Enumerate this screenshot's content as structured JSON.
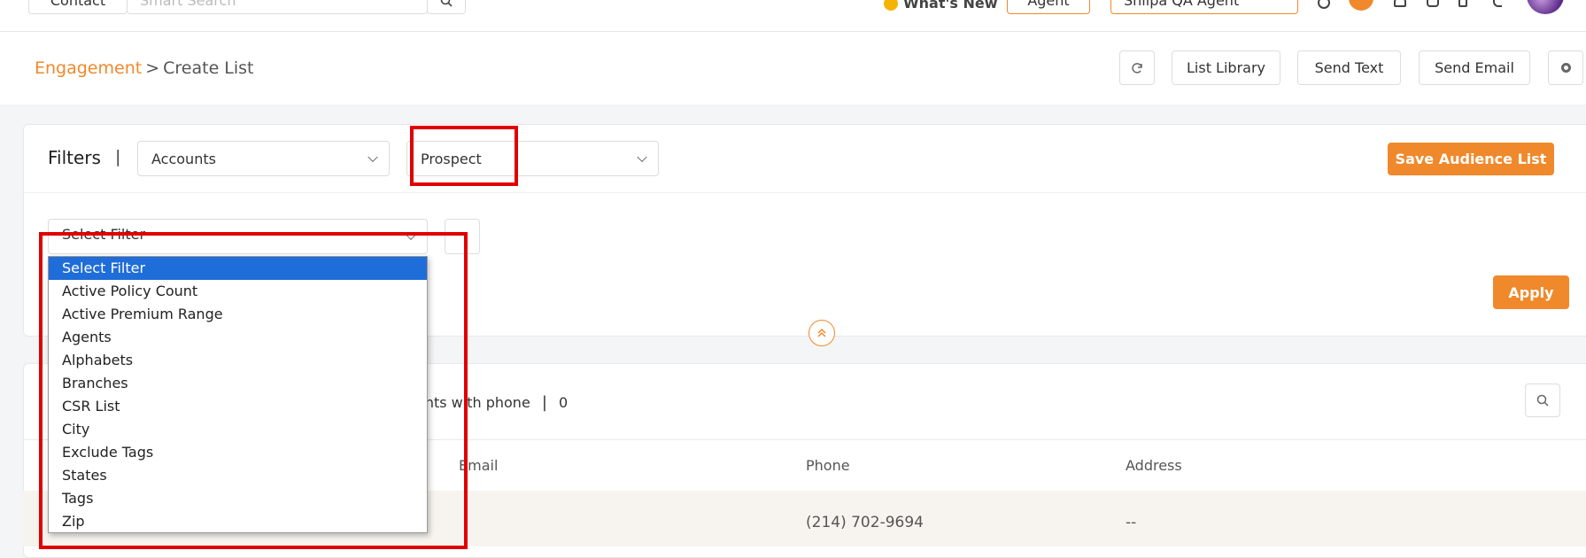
{
  "topbar": {
    "contact_label": "Contact",
    "search_placeholder": "Smart Search",
    "whats_new": "What's New",
    "role_select": "Agent",
    "user_select": "Shilpa QA Agent"
  },
  "breadcrumb": {
    "parent": "Engagement",
    "separator": ">",
    "current": "Create List"
  },
  "header_actions": {
    "list_library": "List Library",
    "send_text": "Send Text",
    "send_email": "Send Email"
  },
  "filters": {
    "label": "Filters",
    "divider": "|",
    "account_type": "Accounts",
    "status": "Prospect",
    "save_button": "Save Audience List",
    "filter_select": "Select Filter",
    "apply_button": "Apply"
  },
  "filter_options": [
    "Select Filter",
    "Active Policy Count",
    "Active Premium Range",
    "Agents",
    "Alphabets",
    "Branches",
    "CSR List",
    "City",
    "Exclude Tags",
    "States",
    "Tags",
    "Zip"
  ],
  "results": {
    "phone_count_label": "ents with phone",
    "phone_divider": "|",
    "phone_count": "0",
    "columns": {
      "email": "Email",
      "phone": "Phone",
      "address": "Address"
    },
    "row": {
      "phone": "(214) 702-9694",
      "address": "--"
    }
  },
  "colors": {
    "accent": "#f0892b",
    "highlight": "#e00000",
    "selected": "#1f6dd8"
  }
}
